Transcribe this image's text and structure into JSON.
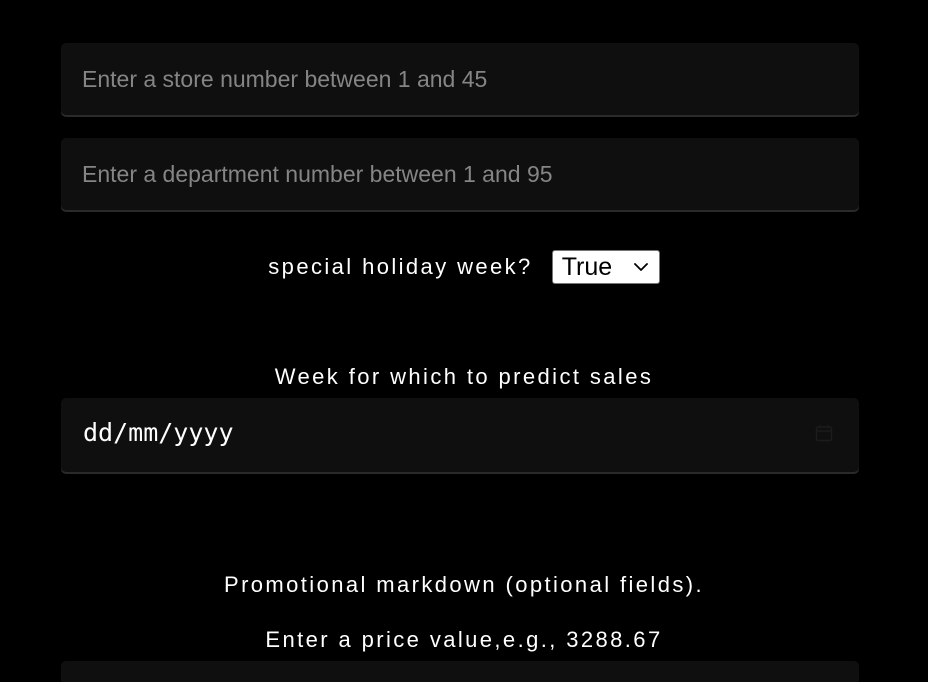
{
  "form": {
    "store_input": {
      "placeholder": "Enter a store number between 1 and 45",
      "value": ""
    },
    "department_input": {
      "placeholder": "Enter a department number between 1 and 95",
      "value": ""
    },
    "holiday": {
      "label": "special holiday week?",
      "selected": "True",
      "icon": "chevron-down-icon"
    },
    "week": {
      "label": "Week for which to predict sales",
      "date_placeholder": "dd/mm/yyyy",
      "icon": "calendar-icon"
    },
    "markdown": {
      "heading": "Promotional markdown (optional fields).",
      "price_label": "Enter a price value,e.g., 3288.67"
    }
  },
  "colors": {
    "background": "#000000",
    "field_background": "#0f0f0f",
    "placeholder_text": "#858585",
    "text": "#ffffff"
  }
}
